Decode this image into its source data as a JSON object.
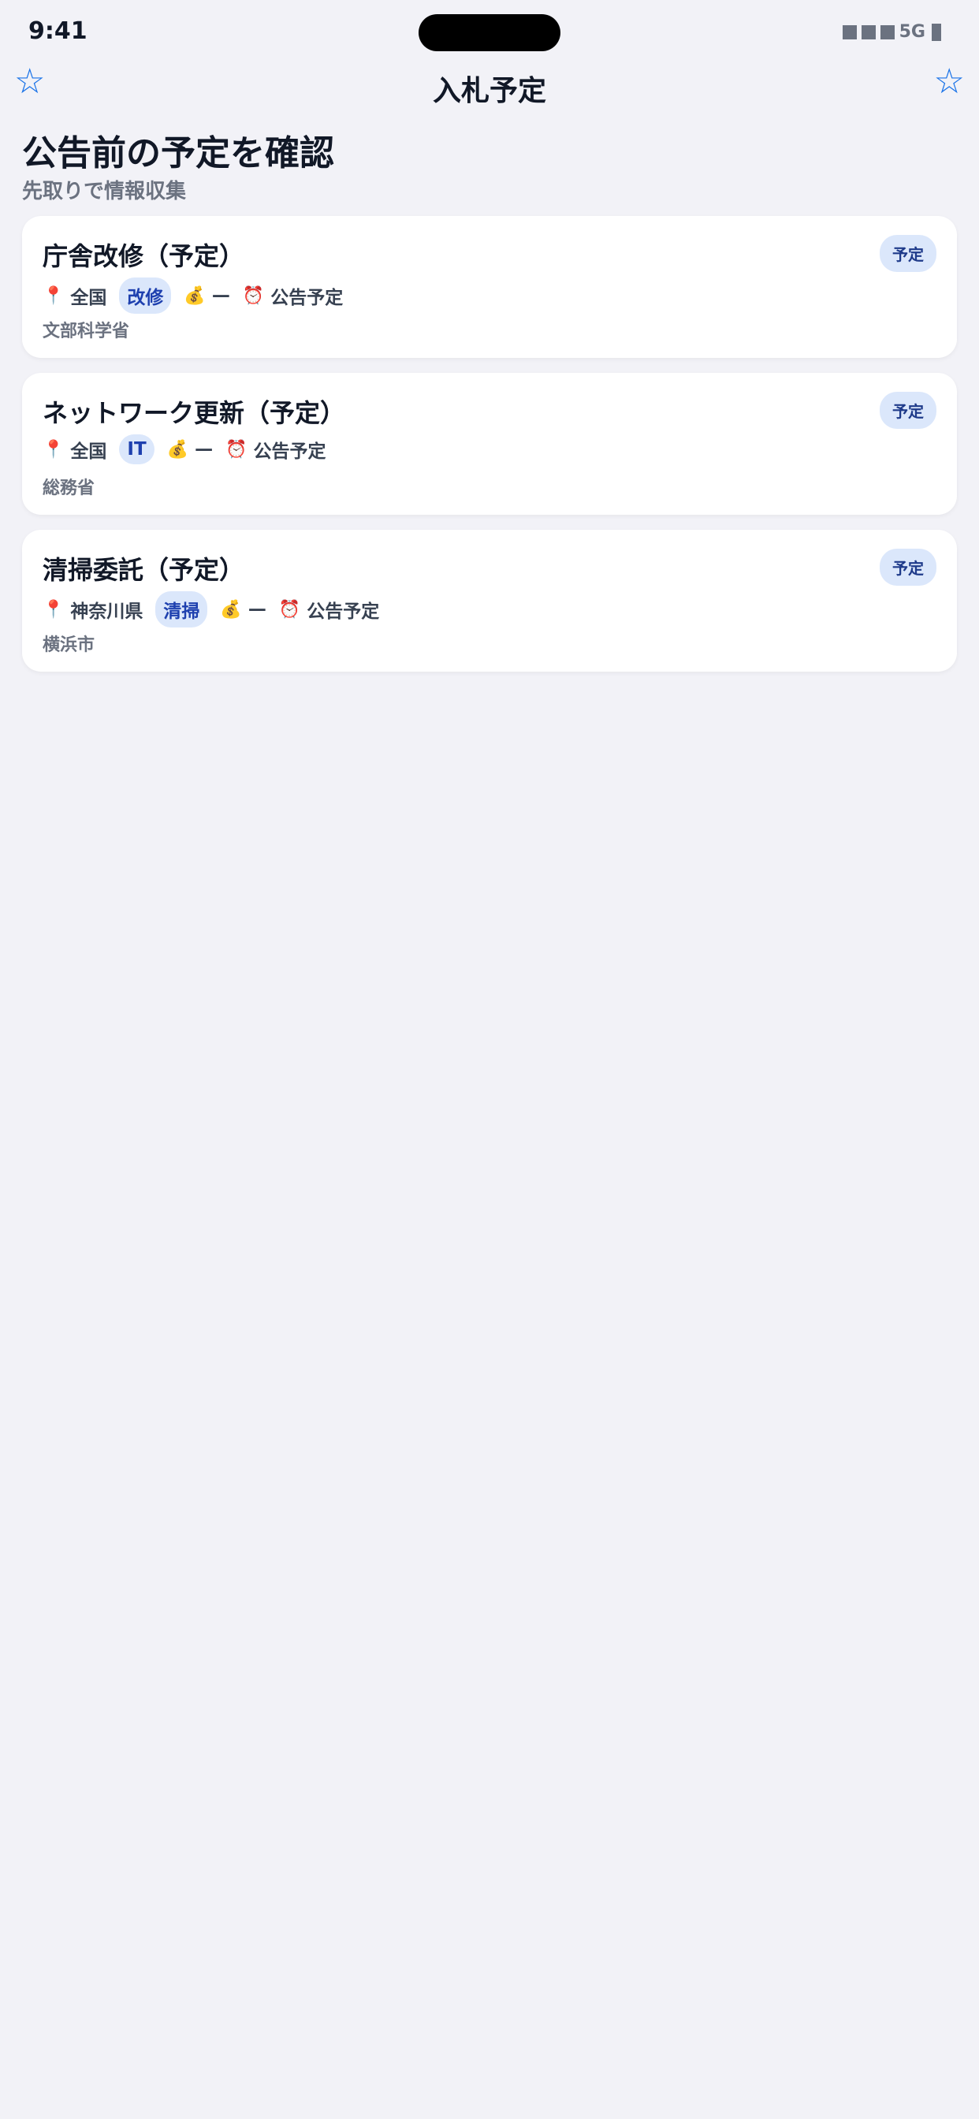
{
  "status_bar": {
    "time": "9:41",
    "network": "5G"
  },
  "nav": {
    "title": "入札予定",
    "left_icon": "star-outline-icon",
    "right_icon": "star-outline-icon",
    "left_glyph": "☆",
    "right_glyph": "☆",
    "accent_color": "#1a73e8"
  },
  "header": {
    "heading": "公告前の予定を確認",
    "subheading": "先取りで情報収集"
  },
  "cards": [
    {
      "title": "庁舎改修（予定）",
      "badge": "予定",
      "location": "全国",
      "category": "改修",
      "budget": "—",
      "deadline": "公告予定",
      "organization": "文部科学省"
    },
    {
      "title": "ネットワーク更新（予定）",
      "badge": "予定",
      "location": "全国",
      "category": "IT",
      "budget": "—",
      "deadline": "公告予定",
      "organization": "総務省"
    },
    {
      "title": "清掃委託（予定）",
      "badge": "予定",
      "location": "神奈川県",
      "category": "清掃",
      "budget": "—",
      "deadline": "公告予定",
      "organization": "横浜市"
    }
  ],
  "icons": {
    "location": "pin-icon",
    "budget": "money-bag-icon",
    "deadline": "alarm-clock-icon"
  },
  "colors": {
    "background": "#f2f2f7",
    "badge_bg": "#dbe7fb",
    "badge_text": "#1e3a8a"
  }
}
